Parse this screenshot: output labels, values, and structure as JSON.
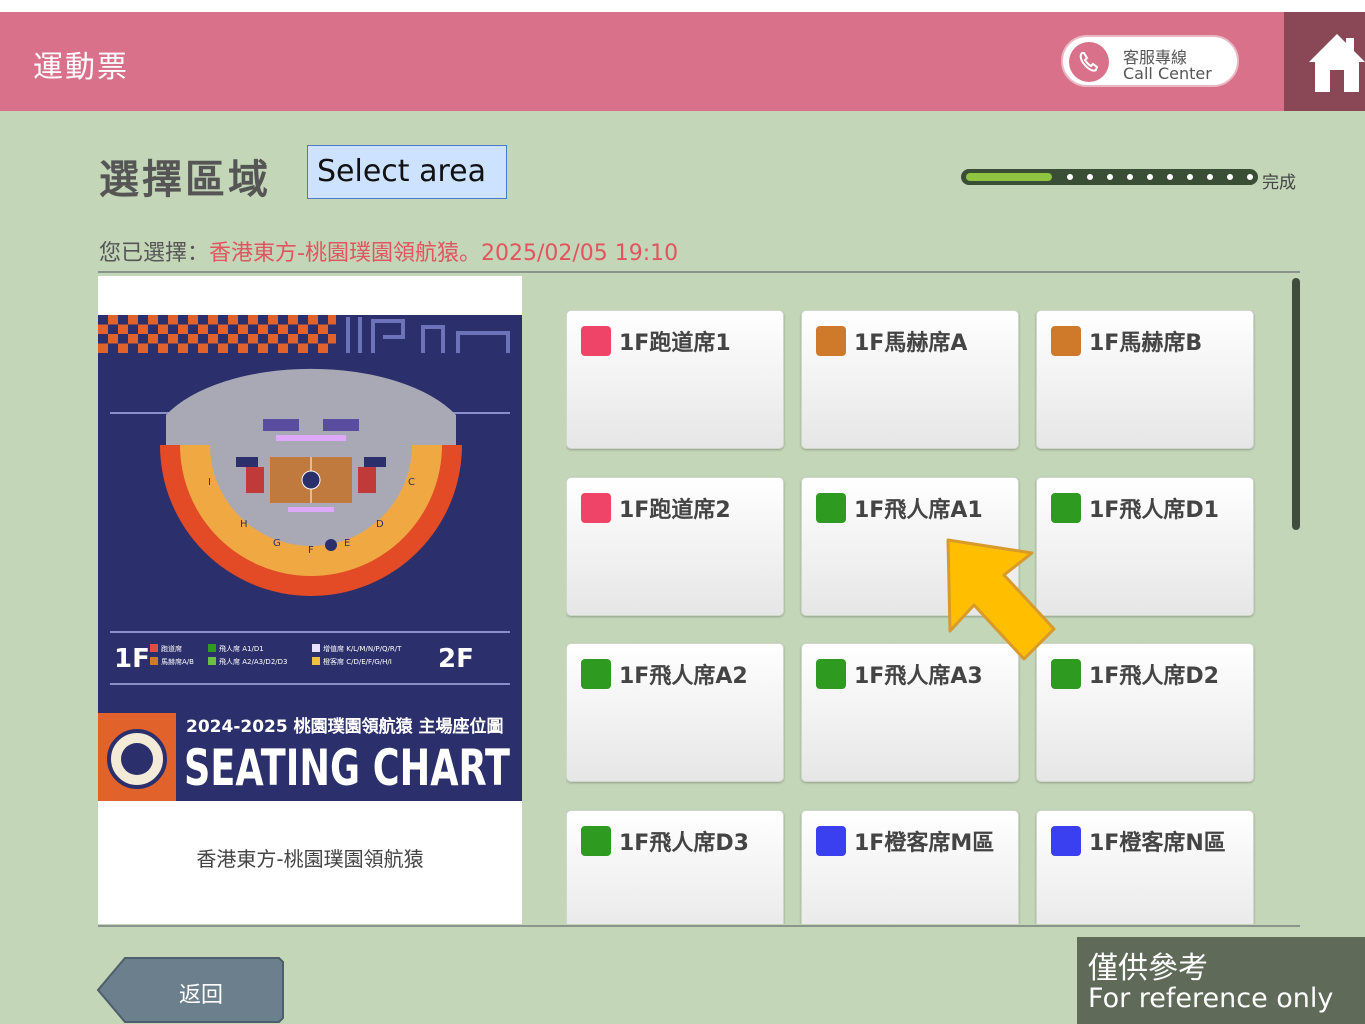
{
  "header": {
    "app_title": "運動票",
    "call_center_line1": "客服專線",
    "call_center_line2": "Call Center"
  },
  "page": {
    "title": "選擇區域",
    "title_en": "Select area",
    "progress_label": "完成",
    "progress_fraction": 0.3,
    "selected_prefix": "您已選擇：",
    "selected_value": "香港東方-桃園璞園領航猿。2025/02/05 19:10"
  },
  "poster": {
    "season_title": "2024-2025 桃園璞園領航猿 主場座位圖",
    "banner": "SEATING CHART",
    "floor_1f": "1F",
    "floor_2f": "2F",
    "legend": [
      "跑道席",
      "飛人席 A1/D1",
      "增值席 K/L/M/N/P/Q/R/T",
      "馬赫席A/B",
      "飛人席 A2/A3/D2/D3",
      "橙客席 C/D/E/F/G/H/I"
    ],
    "section_letters": [
      "I",
      "H",
      "G",
      "F",
      "E",
      "D",
      "C"
    ],
    "caption": "香港東方-桃園璞園領航猿"
  },
  "areas": [
    {
      "label": "1F跑道席1",
      "color": "#ef4468"
    },
    {
      "label": "1F馬赫席A",
      "color": "#cf7a2a"
    },
    {
      "label": "1F馬赫席B",
      "color": "#cf7a2a"
    },
    {
      "label": "1F跑道席2",
      "color": "#ef4468"
    },
    {
      "label": "1F飛人席A1",
      "color": "#2e9a20"
    },
    {
      "label": "1F飛人席D1",
      "color": "#2e9a20"
    },
    {
      "label": "1F飛人席A2",
      "color": "#2e9a20"
    },
    {
      "label": "1F飛人席A3",
      "color": "#2e9a20"
    },
    {
      "label": "1F飛人席D2",
      "color": "#2e9a20"
    },
    {
      "label": "1F飛人席D3",
      "color": "#2e9a20"
    },
    {
      "label": "1F橙客席M區",
      "color": "#3a3ff0"
    },
    {
      "label": "1F橙客席N區",
      "color": "#3a3ff0"
    }
  ],
  "footer": {
    "back_label": "返回",
    "ref_zh": "僅供參考",
    "ref_en": "For reference only"
  },
  "icons": {
    "phone": "phone-icon",
    "home": "home-icon",
    "pointer": "arrow-pointer-icon"
  }
}
